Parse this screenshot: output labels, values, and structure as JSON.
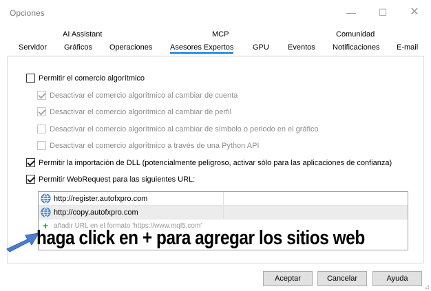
{
  "window": {
    "title": "Opciones",
    "controls": {
      "minimize": "—",
      "maximize": "☐",
      "close": "✕"
    }
  },
  "tabs": {
    "row1": [
      "AI Assistant",
      "MCP",
      "Comunidad"
    ],
    "row2": [
      "Servidor",
      "Gráficos",
      "Operaciones",
      "Asesores Expertos",
      "GPU",
      "Eventos",
      "Notificaciones",
      "E-mail"
    ],
    "active": "Asesores Expertos"
  },
  "options": {
    "algo_trading": {
      "label": "Permitir el comercio algorítmico",
      "checked": false
    },
    "disable_account_change": {
      "label": "Desactivar el comercio algorítmico al cambiar de cuenta",
      "checked": true,
      "enabled": false
    },
    "disable_profile_change": {
      "label": "Desactivar el comercio algorítmico al cambiar de perfil",
      "checked": true,
      "enabled": false
    },
    "disable_symbol_change": {
      "label": "Desactivar el comercio algorítmico al cambiar de símbolo o periodo en el gráfico",
      "checked": false,
      "enabled": false
    },
    "disable_python": {
      "label": "Desactivar el comercio algorítmico a través de una Python API",
      "checked": false,
      "enabled": false
    },
    "dll_import": {
      "label": "Permitir la importación de DLL (potencialmente peligroso, activar sólo para las aplicaciones de confianza)",
      "checked": true
    },
    "webrequest": {
      "label": "Permitir WebRequest para las siguientes URL:",
      "checked": true
    }
  },
  "urls": {
    "items": [
      "http://register.autofxpro.com",
      "http://copy.autofxpro.com"
    ],
    "add_placeholder": "añadir URL en el formato 'https://www.mql5.com'"
  },
  "annotation": {
    "text": "haga click en + para agregar los sitios web",
    "arrow_color": "#4a7fd0"
  },
  "buttons": {
    "ok": "Aceptar",
    "cancel": "Cancelar",
    "help": "Ayuda"
  },
  "colors": {
    "accent": "#0078d7",
    "plus": "#1e9a2e"
  }
}
